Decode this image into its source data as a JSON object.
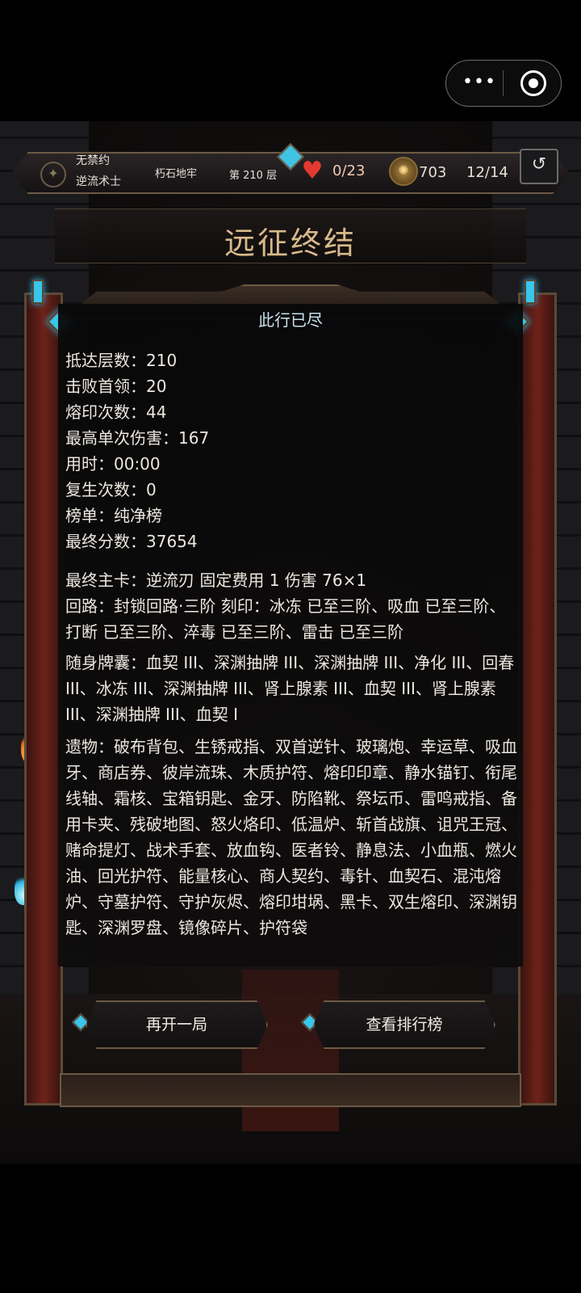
{
  "menu": {
    "more_label": "•••"
  },
  "topbar": {
    "mode": "无禁约",
    "character": "逆流术士",
    "location": "朽石地牢",
    "floor": "第 210 层",
    "hp": "0/23",
    "gold": "703",
    "deck": "12/14",
    "back_glyph": "↺"
  },
  "title": "远征终结",
  "subtitle": "此行已尽",
  "stats": {
    "floors": "抵达层数：210",
    "bosses": "击败首领：20",
    "forges": "熔印次数：44",
    "max_damage": "最高单次伤害：167",
    "time": "用时：00:00",
    "revives": "复生次数：0",
    "board": "榜单：纯净榜",
    "score": "最终分数：37654"
  },
  "main_card": "最终主卡：逆流刃  固定费用 1  伤害 76×1",
  "circuit": "回路：封锁回路·三阶  刻印：冰冻 已至三阶、吸血 已至三阶、打断 已至三阶、淬毒 已至三阶、雷击 已至三阶",
  "pouch": "随身牌囊：血契 III、深渊抽牌 III、深渊抽牌 III、净化 III、回春 III、冰冻 III、深渊抽牌 III、肾上腺素 III、血契 III、肾上腺素 III、深渊抽牌 III、血契 I",
  "relics": "遗物：破布背包、生锈戒指、双首逆针、玻璃炮、幸运草、吸血牙、商店券、彼岸流珠、木质护符、熔印印章、静水锚钉、衔尾线轴、霜核、宝箱钥匙、金牙、防陷靴、祭坛币、雷鸣戒指、备用卡夹、残破地图、怒火烙印、低温炉、斩首战旗、诅咒王冠、赌命提灯、战术手套、放血钩、医者铃、静息法、小血瓶、燃火油、回光护符、能量核心、商人契约、毒针、血契石、混沌熔炉、守墓护符、守护灰烬、熔印坩埚、黑卡、双生熔印、深渊钥匙、深渊罗盘、镜像碎片、护符袋",
  "buttons": {
    "restart": "再开一局",
    "leaderboard": "查看排行榜"
  },
  "colors": {
    "accent_gem": "#39c6ea",
    "title_gold": "#d8b98a",
    "frame_red": "#6e2218",
    "heart": "#e33a30"
  }
}
